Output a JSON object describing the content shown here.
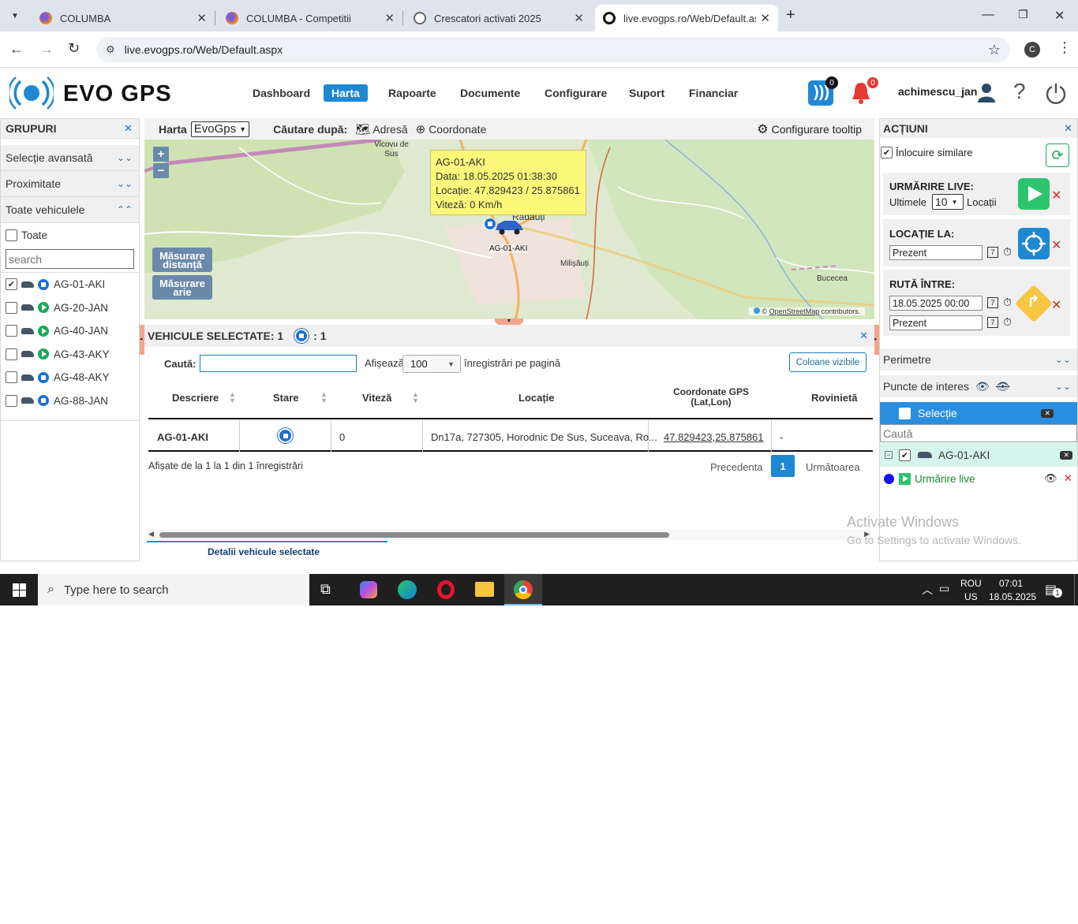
{
  "browser": {
    "tabs": [
      {
        "label": "COLUMBA"
      },
      {
        "label": "COLUMBA - Competitii"
      },
      {
        "label": "Crescatori activati 2025"
      },
      {
        "label": "live.evogps.ro/Web/Default.aspx"
      }
    ],
    "url": "live.evogps.ro/Web/Default.aspx",
    "profile_initial": "C"
  },
  "app": {
    "logo_text": "EVO GPS",
    "nav": [
      "Dashboard",
      "Harta",
      "Rapoarte",
      "Documente",
      "Configurare",
      "Suport",
      "Financiar"
    ],
    "active_nav": "Harta",
    "rss_count": "0",
    "alert_count": "0",
    "username": "achimescu_jan",
    "brand_color": "#1e88d3"
  },
  "left": {
    "title": "GRUPURI",
    "sections": [
      "Selecție avansată",
      "Proximitate",
      "Toate vehiculele"
    ],
    "select_all": "Toate",
    "search_placeholder": "search",
    "vehicles": [
      {
        "name": "AG-01-AKI",
        "checked": true,
        "status": "stop"
      },
      {
        "name": "AG-20-JAN",
        "checked": false,
        "status": "play"
      },
      {
        "name": "AG-40-JAN",
        "checked": false,
        "status": "play"
      },
      {
        "name": "AG-43-AKY",
        "checked": false,
        "status": "play"
      },
      {
        "name": "AG-48-AKY",
        "checked": false,
        "status": "stop"
      },
      {
        "name": "AG-88-JAN",
        "checked": false,
        "status": "stop"
      }
    ]
  },
  "maptoolbar": {
    "harta_label": "Harta",
    "map_provider": "EvoGps",
    "search_by": "Căutare după:",
    "address": "Adresă",
    "coords": "Coordonate",
    "tooltip_config": "Configurare tooltip"
  },
  "map": {
    "zoom_in": "+",
    "zoom_out": "−",
    "measure_distance": "Măsurare distanță",
    "measure_area": "Măsurare arie",
    "places": [
      "Vicovu de Sus",
      "Rădăuți",
      "Milișăuți",
      "Bucecea"
    ],
    "vehicle_label": "AG-01-AKI",
    "popup": {
      "line1": "AG-01-AKI",
      "line2": "Data: 18.05.2025 01:38:30",
      "line3": "Locație: 47.829423 / 25.875861",
      "line4": "Viteză: 0 Km/h"
    },
    "attribution_prefix": "©",
    "attribution_link": "OpenStreetMap",
    "attribution_suffix": "contributors."
  },
  "grid": {
    "title": "VEHICULE SELECTATE: 1",
    "stop_count": ": 1",
    "search_label": "Caută:",
    "show_label": "Afișează",
    "page_size": "100",
    "per_page_label": "înregistrări pe pagină",
    "columns_button": "Coloane vizibile",
    "headers": [
      "Descriere",
      "Stare",
      "Viteză",
      "Locație",
      "Coordonate GPS (Lat,Lon)",
      "Rovinietă"
    ],
    "row": {
      "descriere": "AG-01-AKI",
      "viteza": "0",
      "locatie": "Dn17a, 727305, Horodnic De Sus, Suceava, Ro...",
      "coord": "47.829423,25.875861",
      "rovinieta": "-"
    },
    "info": "Afișate de la 1 la 1 din 1 înregistrări",
    "prev": "Precedenta",
    "page": "1",
    "next": "Următoarea",
    "details_tab": "Detalii vehicule selectate"
  },
  "right": {
    "title": "ACȚIUNI",
    "replace_similar": "Înlocuire similare",
    "live_tracking": "URMĂRIRE LIVE:",
    "last_label": "Ultimele",
    "last_count": "10",
    "locations_label": "Locații",
    "location_at": "LOCAȚIE LA:",
    "location_value": "Prezent",
    "route_between": "RUTĂ ÎNTRE:",
    "route_from": "18.05.2025 00:00",
    "route_to": "Prezent",
    "calendar_day": "7",
    "perimeters": "Perimetre",
    "poi": "Puncte de interes",
    "selection": "Selecție",
    "search_placeholder": "Caută",
    "tree_item": "AG-01-AKI",
    "live_item": "Urmărire live"
  },
  "watermark": {
    "line1": "Activate Windows",
    "line2": "Go to Settings to activate Windows."
  },
  "taskbar": {
    "search_placeholder": "Type here to search",
    "lang1": "ROU",
    "lang2": "US",
    "time": "07:01",
    "date": "18.05.2025",
    "notif_count": "1"
  }
}
